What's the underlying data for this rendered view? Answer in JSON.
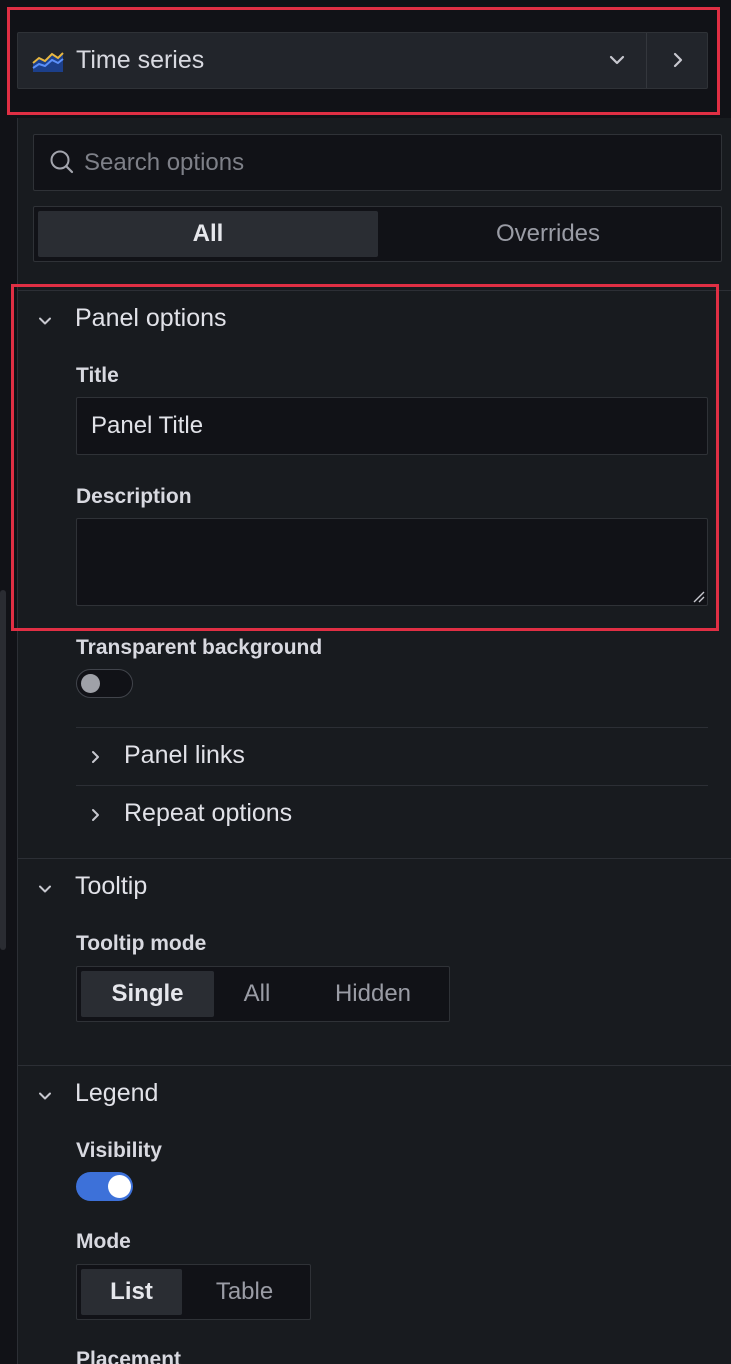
{
  "header": {
    "visualization_label": "Time series",
    "icon": "time-series-icon",
    "dropdown_icon": "chevron-down-icon",
    "next_icon": "chevron-right-icon"
  },
  "search": {
    "placeholder": "Search options",
    "icon": "search-icon"
  },
  "tabs": [
    {
      "label": "All",
      "active": true
    },
    {
      "label": "Overrides",
      "active": false
    }
  ],
  "panel_options": {
    "title": "Panel options",
    "title_label": "Title",
    "title_value": "Panel Title",
    "description_label": "Description",
    "description_value": "",
    "transparent_label": "Transparent background",
    "transparent_enabled": false,
    "links_label": "Panel links",
    "repeat_label": "Repeat options"
  },
  "tooltip": {
    "title": "Tooltip",
    "mode_label": "Tooltip mode",
    "modes": [
      "Single",
      "All",
      "Hidden"
    ],
    "selected": "Single"
  },
  "legend": {
    "title": "Legend",
    "visibility_label": "Visibility",
    "visibility_enabled": true,
    "mode_label": "Mode",
    "modes": [
      "List",
      "Table"
    ],
    "selected": "List",
    "placement_label": "Placement"
  },
  "colors": {
    "highlight": "#e02f44",
    "toggle_on": "#3d71d9",
    "background": "#181b1f"
  }
}
